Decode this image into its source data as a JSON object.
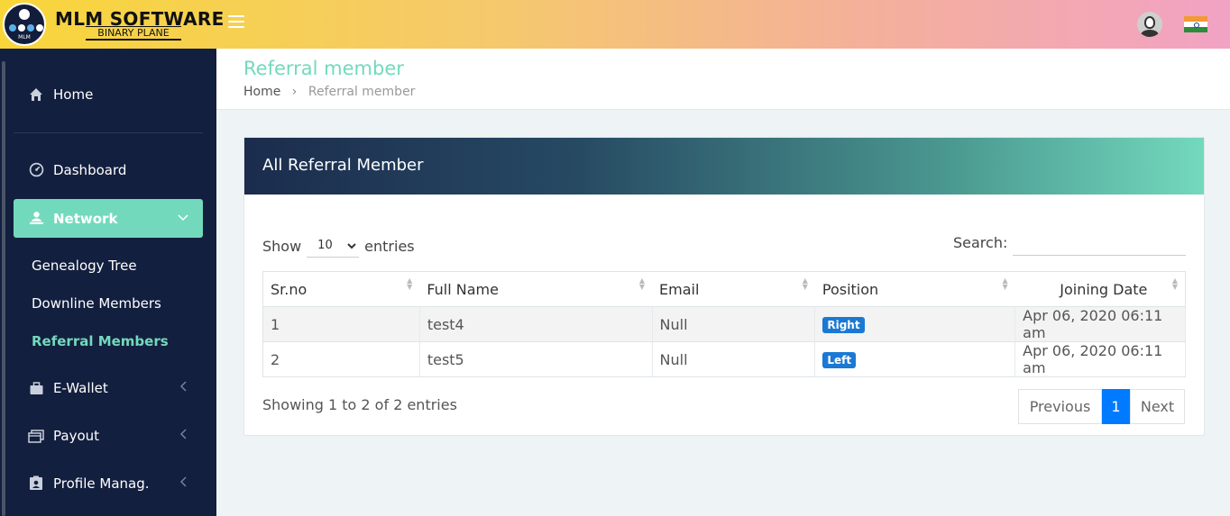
{
  "brand": {
    "title": "MLM SOFTWARE",
    "subtitle": "BINARY PLANE",
    "logo_text": "MLM"
  },
  "topbar": {
    "menu_icon": "hamburger-icon",
    "avatar_icon": "user-avatar-icon",
    "flag_icon": "india-flag-icon"
  },
  "sidebar": {
    "home": "Home",
    "dashboard": "Dashboard",
    "network": "Network",
    "submenu": [
      "Genealogy Tree",
      "Downline Members",
      "Referral Members"
    ],
    "ewallet": "E-Wallet",
    "payout": "Payout",
    "profile": "Profile Manag."
  },
  "page": {
    "title": "Referral member",
    "breadcrumb": {
      "home": "Home",
      "current": "Referral member"
    }
  },
  "card": {
    "title": "All Referral Member",
    "show_label": "Show",
    "entries_label": "entries",
    "page_size": "10",
    "page_size_options": [
      "10"
    ],
    "search_label": "Search:",
    "search_value": ""
  },
  "table": {
    "columns": [
      "Sr.no",
      "Full Name",
      "Email",
      "Position",
      "Joining Date"
    ],
    "rows": [
      {
        "srno": "1",
        "name": "test4",
        "email": "Null",
        "position": "Right",
        "date": "Apr 06, 2020 06:11 am"
      },
      {
        "srno": "2",
        "name": "test5",
        "email": "Null",
        "position": "Left",
        "date": "Apr 06, 2020 06:11 am"
      }
    ]
  },
  "footer": {
    "info": "Showing 1 to 2 of 2 entries",
    "previous": "Previous",
    "page": "1",
    "next": "Next"
  },
  "colors": {
    "accent": "#73d9bd",
    "sidebar_bg": "#131f3e",
    "badge": "#1b79d4",
    "pager_active": "#007bff"
  }
}
